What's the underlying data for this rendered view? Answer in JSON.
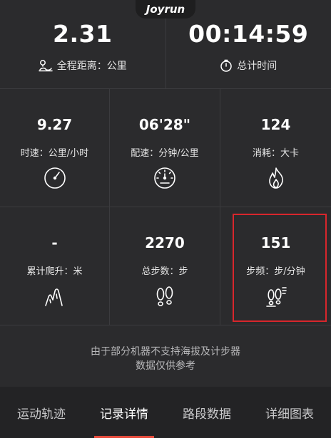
{
  "brand": "Joyrun",
  "summary": {
    "distance": {
      "value": "2.31",
      "label": "全程距离：公里",
      "icon": "route-icon"
    },
    "time": {
      "value": "00:14:59",
      "label": "总计时间",
      "icon": "stopwatch-icon"
    }
  },
  "metrics": {
    "speed": {
      "value": "9.27",
      "label": "时速：公里/小时",
      "icon": "speedometer-icon"
    },
    "pace": {
      "value": "06'28\"",
      "label": "配速：分钟/公里",
      "icon": "gauge-icon"
    },
    "calories": {
      "value": "124",
      "label": "消耗：大卡",
      "icon": "flame-icon"
    },
    "climb": {
      "value": "-",
      "label": "累计爬升：米",
      "icon": "mountain-icon"
    },
    "steps": {
      "value": "2270",
      "label": "总步数：步",
      "icon": "footprints-icon"
    },
    "cadence": {
      "value": "151",
      "label": "步频：步/分钟",
      "icon": "footprints-lines-icon"
    }
  },
  "note": {
    "line1": "由于部分机器不支持海拔及计步器",
    "line2": "数据仅供参考"
  },
  "tabs": [
    {
      "label": "运动轨迹",
      "active": false
    },
    {
      "label": "记录详情",
      "active": true
    },
    {
      "label": "路段数据",
      "active": false
    },
    {
      "label": "详细图表",
      "active": false
    }
  ],
  "colors": {
    "background": "#2b2b2d",
    "tabbar": "#232325",
    "highlight": "#d8262c",
    "tab_indicator": "#e64b3c"
  }
}
